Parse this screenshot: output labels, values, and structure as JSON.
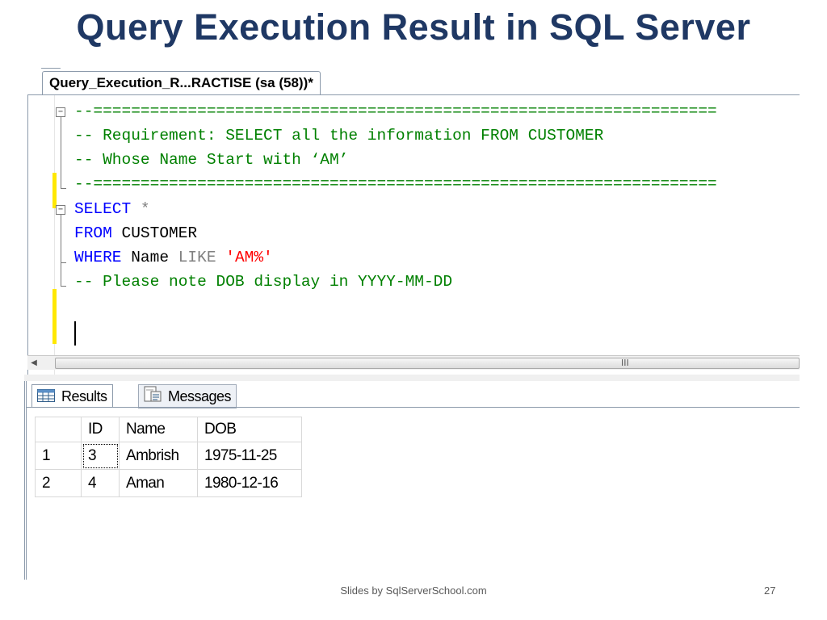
{
  "slide": {
    "title": "Query Execution Result in SQL Server",
    "footer": "Slides by SqlServerSchool.com",
    "page_number": "27"
  },
  "editor": {
    "tab_label": "Query_Execution_R...RACTISE (sa (58))*",
    "code": {
      "line1": "--==================================================================",
      "line2": "-- Requirement: SELECT all the information FROM CUSTOMER",
      "line3": "-- Whose Name Start with ‘AM’",
      "line4": "--==================================================================",
      "select_kw": "SELECT",
      "select_star": "*",
      "from_kw": "FROM",
      "from_table": "CUSTOMER",
      "where_kw": "WHERE",
      "where_col": "Name",
      "like_kw": "LIKE",
      "like_value": "'AM%'",
      "line8": "-- Please note DOB display in YYYY-MM-DD"
    },
    "scrollbar_grip": "III"
  },
  "results": {
    "tabs": [
      {
        "label": "Results",
        "icon": "grid-icon"
      },
      {
        "label": "Messages",
        "icon": "messages-icon"
      }
    ],
    "columns": [
      "ID",
      "Name",
      "DOB"
    ],
    "rows": [
      {
        "num": "1",
        "id": "3",
        "name": "Ambrish",
        "dob": "1975-11-25"
      },
      {
        "num": "2",
        "id": "4",
        "name": "Aman",
        "dob": "1980-12-16"
      }
    ]
  },
  "colors": {
    "title": "#1f3864",
    "comment": "#008000",
    "keyword": "#0000ff",
    "string": "#ff0000",
    "change_bar": "#ffe800"
  }
}
